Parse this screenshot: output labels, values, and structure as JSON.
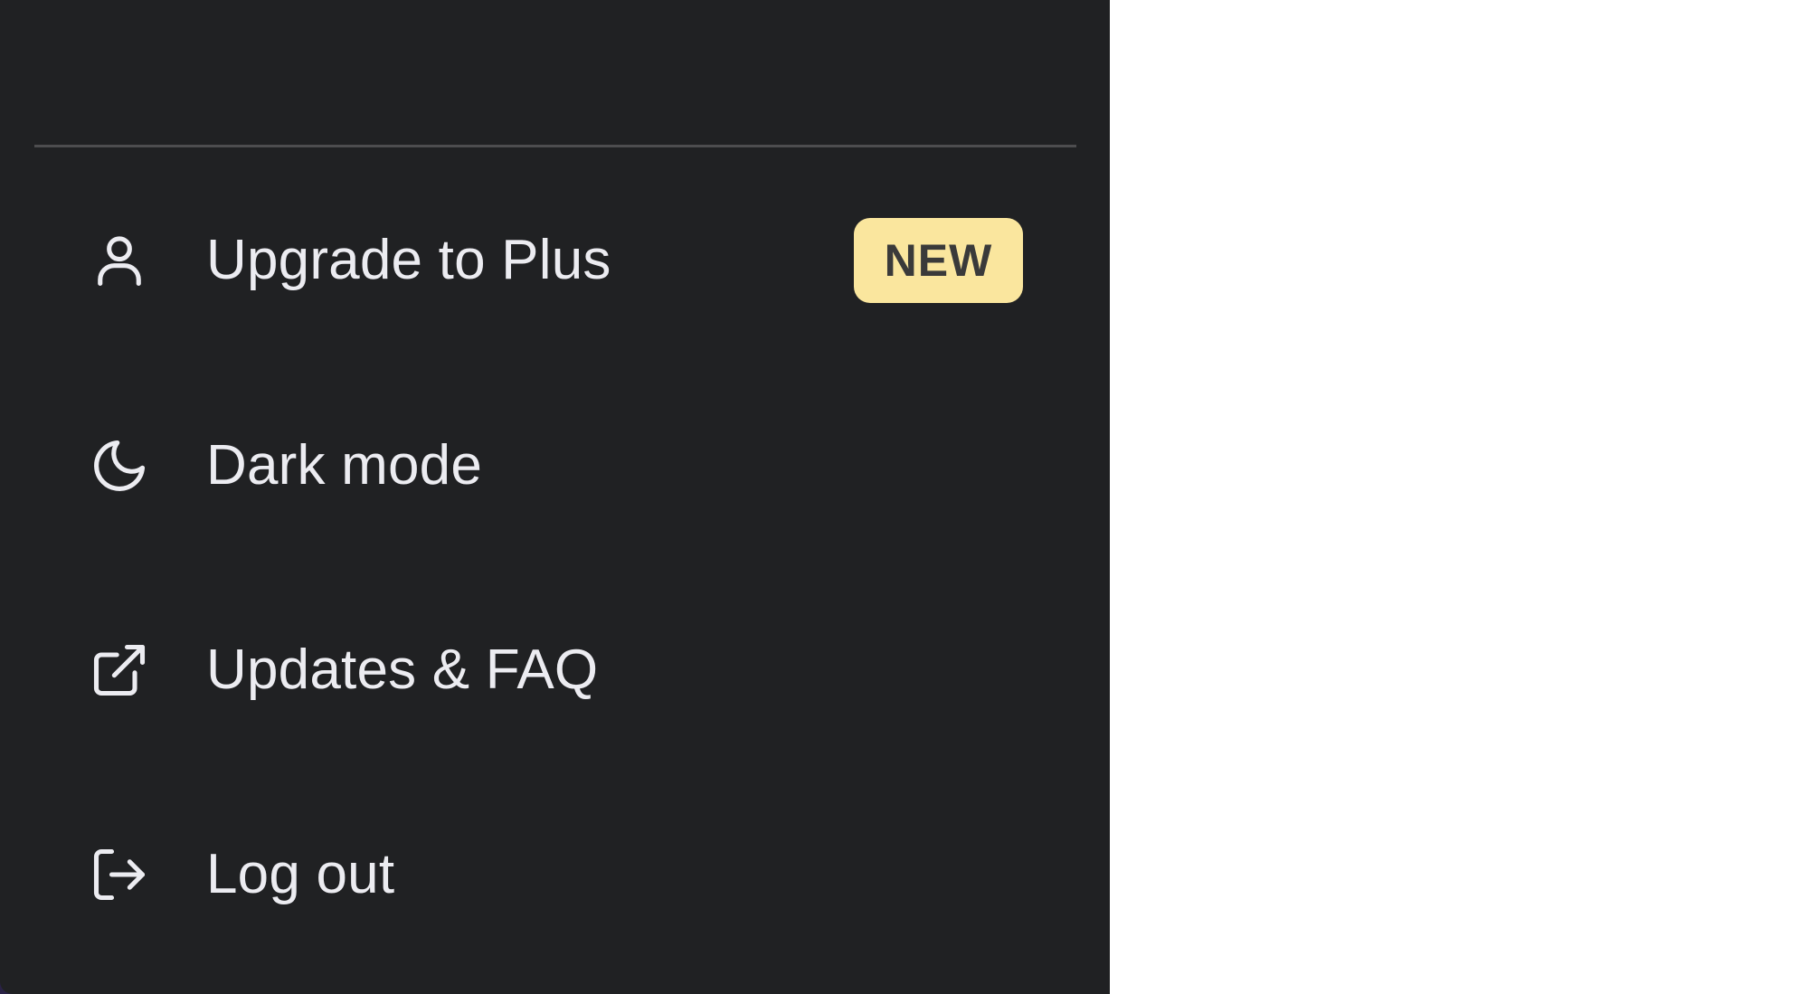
{
  "menu": {
    "items": [
      {
        "label": "Upgrade to Plus",
        "icon": "user-icon",
        "badge": "NEW"
      },
      {
        "label": "Dark mode",
        "icon": "moon-icon"
      },
      {
        "label": "Updates & FAQ",
        "icon": "external-link-icon"
      },
      {
        "label": "Log out",
        "icon": "logout-icon"
      }
    ]
  },
  "colors": {
    "panel_bg": "#202123",
    "text": "#ececf1",
    "badge_bg": "#fae69e",
    "divider": "#4d4d4f"
  }
}
